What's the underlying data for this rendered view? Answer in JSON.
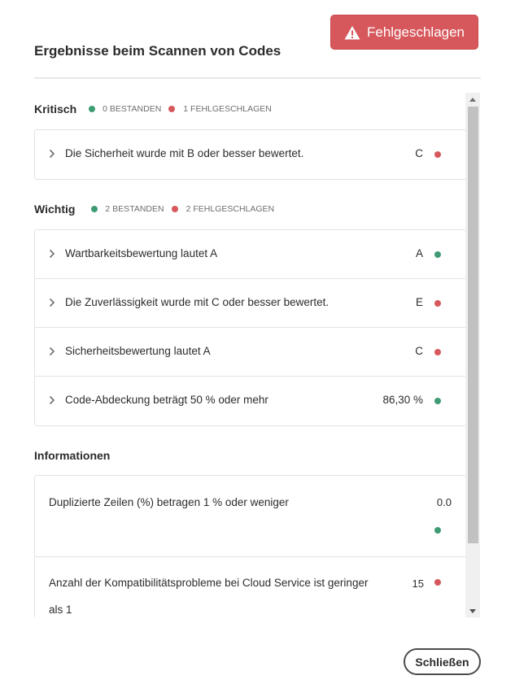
{
  "header": {
    "status_label": "Fehlgeschlagen",
    "status_icon": "warning-icon",
    "title": "Ergebnisse beim Scannen von Codes"
  },
  "colors": {
    "passed": "#3e9b73",
    "failed": "#d7585c"
  },
  "sections": {
    "critical": {
      "title": "Kritisch",
      "passed_label": "0 BESTANDEN",
      "failed_label": "1 FEHLGESCHLAGEN",
      "rows": [
        {
          "label": "Die Sicherheit wurde mit B oder besser bewertet.",
          "value": "C",
          "status": "failed"
        }
      ]
    },
    "important": {
      "title": "Wichtig",
      "passed_label": "2 BESTANDEN",
      "failed_label": "2 FEHLGESCHLAGEN",
      "rows": [
        {
          "label": "Wartbarkeitsbewertung lautet A",
          "value": "A",
          "status": "passed"
        },
        {
          "label": "Die Zuverlässigkeit wurde mit C oder besser bewertet.",
          "value": "E",
          "status": "failed"
        },
        {
          "label": "Sicherheitsbewertung lautet A",
          "value": "C",
          "status": "failed"
        },
        {
          "label": "Code-Abdeckung beträgt 50 % oder mehr",
          "value": "86,30 %",
          "status": "passed"
        }
      ]
    },
    "info": {
      "title": "Informationen",
      "rows": [
        {
          "label": "Duplizierte Zeilen (%) betragen 1 % oder weniger",
          "value": "0.0",
          "status": "passed"
        },
        {
          "label": "Anzahl der Kompatibilitätsprobleme bei Cloud Service ist geringer als 1",
          "value": "15",
          "status": "failed"
        }
      ]
    }
  },
  "footer": {
    "close_label": "Schließen"
  }
}
